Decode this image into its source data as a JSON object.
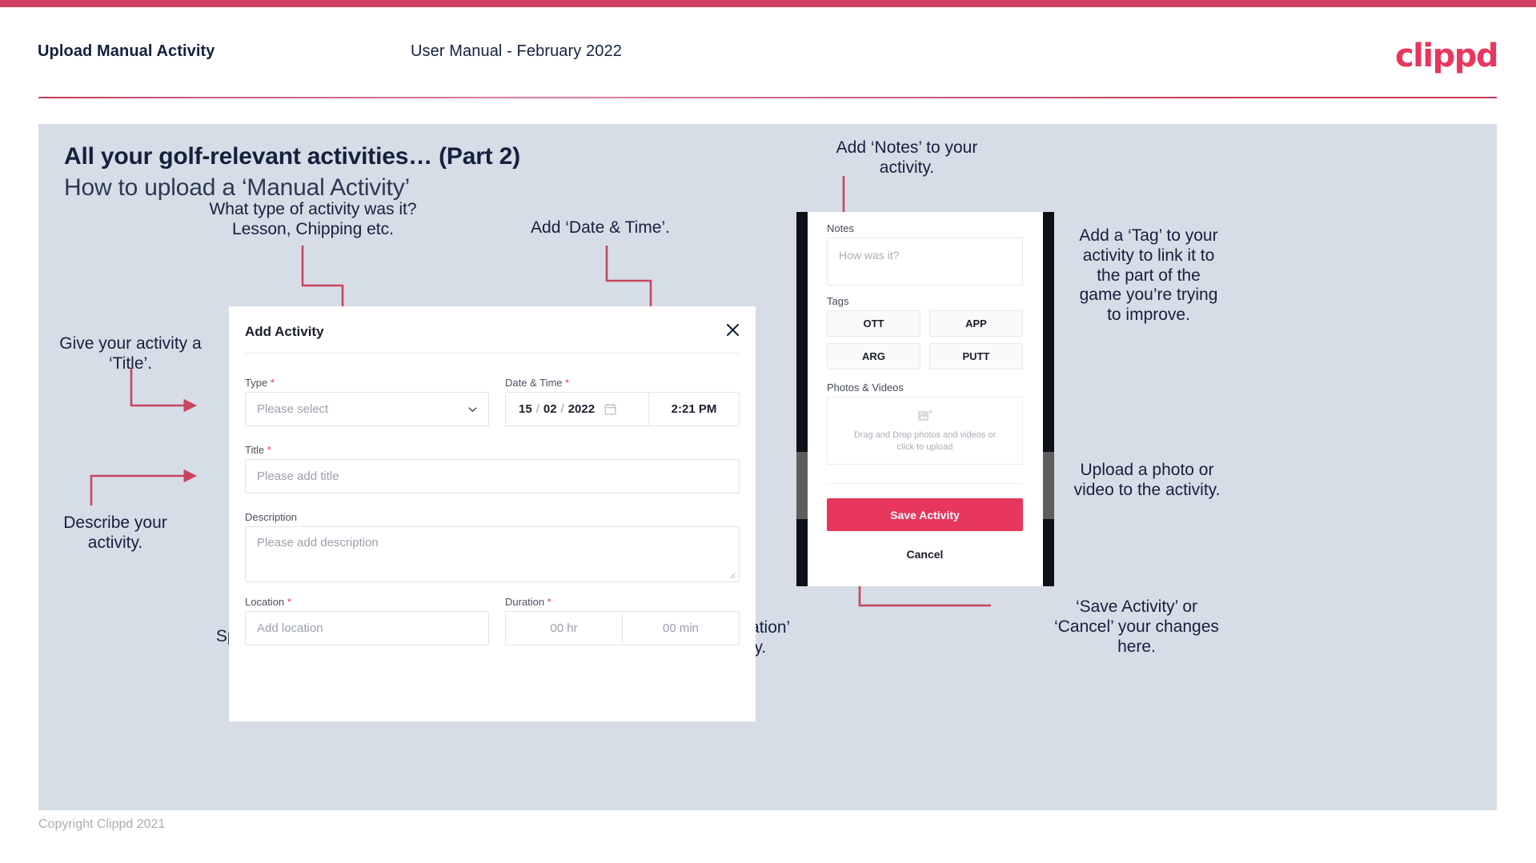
{
  "header": {
    "left_title": "Upload Manual Activity",
    "center_title": "User Manual - February 2022",
    "logo": "clippd"
  },
  "slide": {
    "title_bold": "All your golf-relevant activities… (Part 2)",
    "title_regular": "How to upload a ‘Manual Activity’"
  },
  "annotations": {
    "type": "What type of activity was it?\nLesson, Chipping etc.",
    "datetime": "Add ‘Date & Time’.",
    "title": "Give your activity a\n‘Title’.",
    "description": "Describe your\nactivity.",
    "location": "Specify the ‘Location’.",
    "duration": "Specify the ‘Duration’\nof your activity.",
    "notes": "Add ‘Notes’ to your\nactivity.",
    "tags": "Add a ‘Tag’ to your\nactivity to link it to\nthe part of the\ngame you’re trying\nto improve.",
    "upload": "Upload a photo or\nvideo to the activity.",
    "save_cancel": "‘Save Activity’ or\n‘Cancel’ your changes\nhere."
  },
  "dialog": {
    "title": "Add Activity",
    "close_icon": "close-icon",
    "fields": {
      "type": {
        "label": "Type",
        "required": "*",
        "placeholder": "Please select"
      },
      "datetime": {
        "label": "Date & Time",
        "required": "*",
        "day": "15",
        "sep1": "/",
        "month": "02",
        "sep2": "/",
        "year": "2022",
        "time": "2:21 PM",
        "calendar_icon": "calendar-icon"
      },
      "title": {
        "label": "Title",
        "required": "*",
        "placeholder": "Please add title"
      },
      "description": {
        "label": "Description",
        "required": "",
        "placeholder": "Please add description"
      },
      "location": {
        "label": "Location",
        "required": "*",
        "placeholder": "Add location"
      },
      "duration": {
        "label": "Duration",
        "required": "*",
        "hours": "00 hr",
        "minutes": "00 min"
      }
    }
  },
  "phone": {
    "notes_label": "Notes",
    "notes_placeholder": "How was it?",
    "tags_label": "Tags",
    "tags": [
      "OTT",
      "APP",
      "ARG",
      "PUTT"
    ],
    "photos_label": "Photos & Videos",
    "drop_text": "Drag and Drop photos and videos or click to upload",
    "save_label": "Save Activity",
    "cancel_label": "Cancel"
  },
  "footer": {
    "copyright": "Copyright Clippd 2021"
  },
  "colors": {
    "accent": "#e8365d",
    "rule": "#cf4061",
    "slide_bg": "#d6dde6",
    "text": "#14213d",
    "arrow": "#c8455f"
  }
}
